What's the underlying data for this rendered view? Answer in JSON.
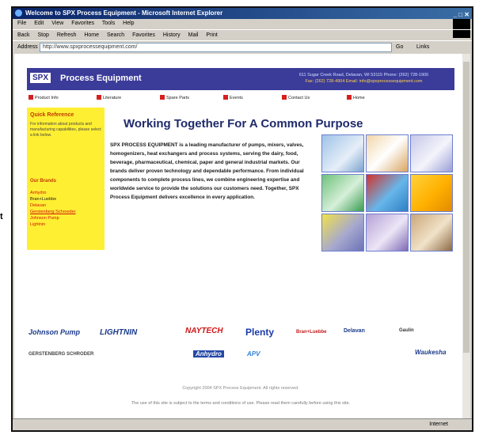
{
  "browser": {
    "title": "Welcome to SPX Process Equipment - Microsoft Internet Explorer",
    "menu": [
      "File",
      "Edit",
      "View",
      "Favorites",
      "Tools",
      "Help"
    ],
    "toolbar": [
      "Back",
      "Stop",
      "Refresh",
      "Home",
      "Search",
      "Favorites",
      "History",
      "Mail",
      "Print"
    ],
    "address_label": "Address",
    "address_value": "http://www.spxprocessequipment.com/",
    "go_label": "Go",
    "links_label": "Links",
    "status_text": "",
    "zone_text": "Internet"
  },
  "site": {
    "logo": "SPX",
    "brand": "Process Equipment",
    "address_line1": "611 Sugar Creek Road, Delavan, WI 53115 Phone: (262) 728-1900",
    "address_line2": "Fax: (262) 728-4904 Email: info@spxprocessequipment.com",
    "nav": [
      "Product Info",
      "Literature",
      "Spare Parts",
      "Events",
      "Contact Us",
      "Home"
    ],
    "sidebar": {
      "title": "Quick Reference",
      "text": "For information about products and manufacturing capabilities, please select a link below.",
      "subtitle": "Our Brands",
      "links": [
        "Anhydro",
        "Bran+Luebbe",
        "Delavan",
        "Gerstenberg Schroeder",
        "Johnson Pump",
        "Lightnin"
      ]
    },
    "headline": "Working Together For A Common Purpose",
    "body": "SPX PROCESS EQUIPMENT is a leading manufacturer of pumps, mixers, valves, homogenizers, heat exchangers and process systems, serving the dairy, food, beverage, pharmaceutical, chemical, paper and general industrial markets. Our brands deliver proven technology and dependable performance. From individual components to complete process lines, we combine engineering expertise and worldwide service to provide the solutions our customers need. Together, SPX Process Equipment delivers excellence in every application.",
    "brands": [
      "Johnson Pump",
      "LIGHTNIN",
      "NAYTECH",
      "Plenty",
      "Bran+Luebbe",
      "Delavan",
      "Gaulin",
      "GERSTENBERG SCHRODER",
      "Anhydro",
      "APV",
      "Waukesha"
    ],
    "footer1": "Copyright 2004 SPX Process Equipment. All rights reserved.",
    "footer2": "The use of this site is subject to the terms and conditions of use. Please read them carefully before using this site."
  },
  "side_char": "t"
}
